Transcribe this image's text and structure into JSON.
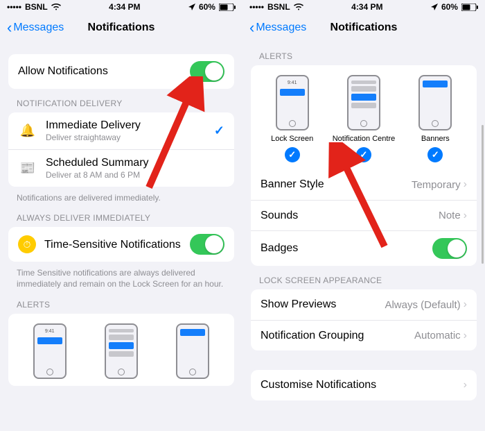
{
  "status": {
    "carrier": "BSNL",
    "time": "4:34 PM",
    "battery": "60%"
  },
  "nav": {
    "back": "Messages",
    "title": "Notifications"
  },
  "left": {
    "allow": "Allow Notifications",
    "delivery_header": "NOTIFICATION DELIVERY",
    "immediate_title": "Immediate Delivery",
    "immediate_sub": "Deliver straightaway",
    "scheduled_title": "Scheduled Summary",
    "scheduled_sub": "Deliver at 8 AM and 6 PM",
    "delivery_footer": "Notifications are delivered immediately.",
    "always_header": "ALWAYS DELIVER IMMEDIATELY",
    "time_sensitive": "Time-Sensitive Notifications",
    "time_sensitive_footer": "Time Sensitive notifications are always delivered immediately and remain on the Lock Screen for an hour.",
    "alerts_header": "ALERTS",
    "lock_time": "9:41"
  },
  "right": {
    "alerts_header": "ALERTS",
    "opt_lock": "Lock Screen",
    "opt_centre": "Notification Centre",
    "opt_banners": "Banners",
    "banner_style": "Banner Style",
    "banner_style_val": "Temporary",
    "sounds": "Sounds",
    "sounds_val": "Note",
    "badges": "Badges",
    "lockscreen_header": "LOCK SCREEN APPEARANCE",
    "show_previews": "Show Previews",
    "show_previews_val": "Always (Default)",
    "grouping": "Notification Grouping",
    "grouping_val": "Automatic",
    "customise": "Customise Notifications",
    "lock_time": "9:41"
  }
}
